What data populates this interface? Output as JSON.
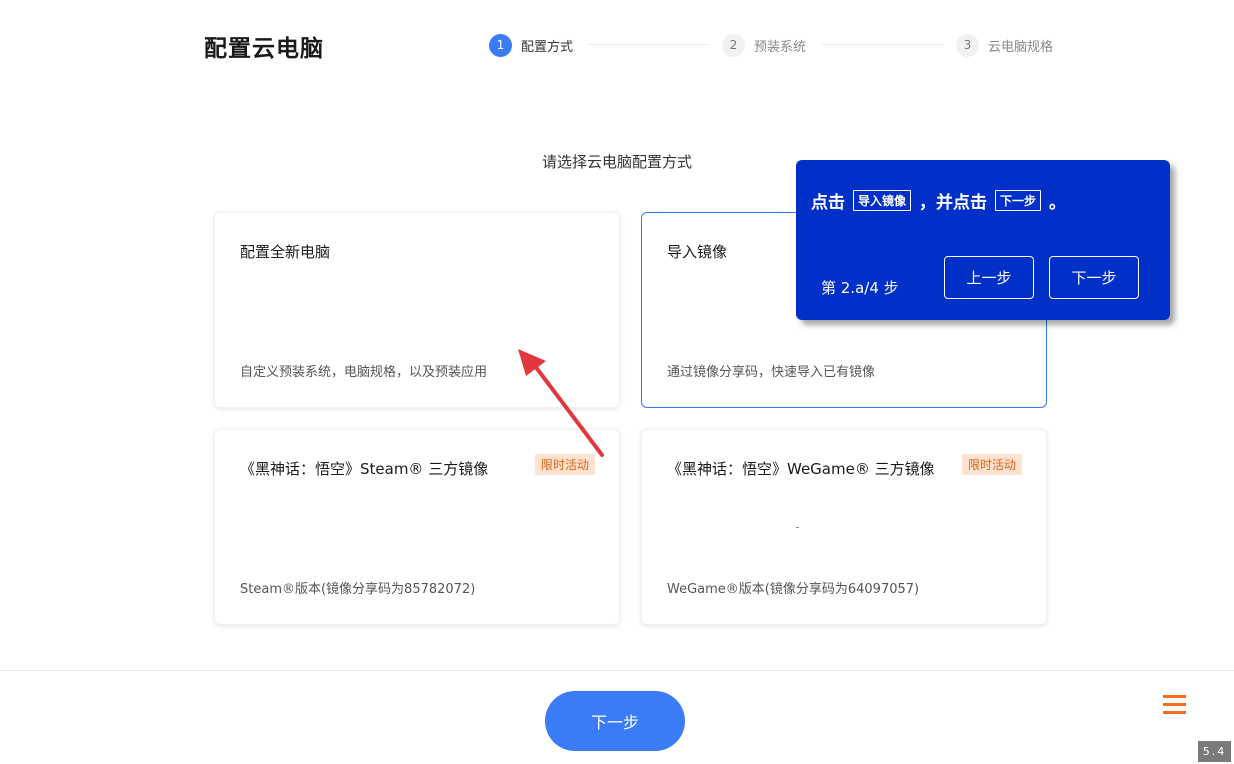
{
  "header": {
    "title": "配置云电脑",
    "steps": [
      {
        "number": "1",
        "label": "配置方式",
        "active": true
      },
      {
        "number": "2",
        "label": "预装系统",
        "active": false
      },
      {
        "number": "3",
        "label": "云电脑规格",
        "active": false
      }
    ]
  },
  "main": {
    "subtitle": "请选择云电脑配置方式",
    "cards": [
      {
        "title": "配置全新电脑",
        "desc": "自定义预装系统，电脑规格，以及预装应用"
      },
      {
        "title": "导入镜像",
        "desc": "通过镜像分享码，快速导入已有镜像"
      },
      {
        "title": "《黑神话：悟空》Steam® 三方镜像",
        "desc": "Steam®版本(镜像分享码为85782072)",
        "badge": "限时活动"
      },
      {
        "title": "《黑神话：悟空》WeGame® 三方镜像",
        "desc": "WeGame®版本(镜像分享码为64097057)",
        "badge": "限时活动"
      }
    ]
  },
  "footer": {
    "next_label": "下一步",
    "version": "5.4",
    "menu_icon": "hamburger-menu-icon"
  },
  "tour": {
    "text_prefix": "点击",
    "key1": "导入镜像",
    "text_middle": "，并点击",
    "key2": "下一步",
    "text_suffix": "。",
    "progress": "第 2.a/4 步",
    "prev_label": "上一步",
    "next_label": "下一步"
  },
  "colors": {
    "primary": "#3a7bf7",
    "tour_bg": "#0030c8",
    "badge_bg": "#fde3cf",
    "badge_text": "#e0651a",
    "arrow": "#e0383e",
    "menu": "#f36b1c"
  }
}
